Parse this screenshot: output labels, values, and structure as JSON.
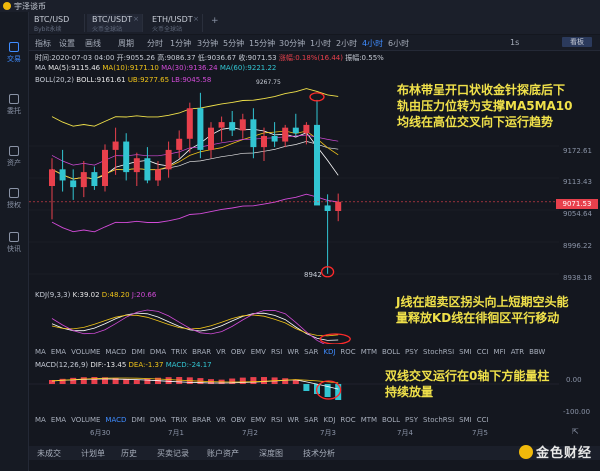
{
  "window": {
    "brand": "宇泽谈币"
  },
  "sidebar": {
    "items": [
      {
        "label": "交易",
        "icon": "candlestick-icon"
      },
      {
        "label": "委托",
        "icon": "order-icon"
      },
      {
        "label": "资产",
        "icon": "wallet-icon"
      },
      {
        "label": "授权",
        "icon": "key-icon"
      },
      {
        "label": "快讯",
        "icon": "news-icon"
      }
    ]
  },
  "symbols": [
    {
      "name": "BTC/USD",
      "sub": "Bybit永续"
    },
    {
      "name": "BTC/USDT",
      "sub": "火币全球站"
    },
    {
      "name": "ETH/USDT",
      "sub": "火币全球站"
    }
  ],
  "toolbar": {
    "items": [
      "指标",
      "设置",
      "画线",
      "周期",
      "分时",
      "1分钟",
      "3分钟",
      "5分钟",
      "15分钟",
      "30分钟",
      "1小时",
      "2小时",
      "4小时",
      "6小时"
    ],
    "active": "4小时",
    "extra": "1s",
    "big": "看板"
  },
  "info": {
    "time": "时间:2020-07-03 04:00",
    "open": "开:9055.26",
    "high": "高:9086.37",
    "low": "低:9036.67",
    "close": "收:9071.53",
    "change": "涨幅:0.18%(16.44)",
    "amp": "振幅:0.55%",
    "ma_label": "MA",
    "ma5": "MA(5):9115.46",
    "ma10": "MA(10):9171.10",
    "ma30": "MA(30):9136.24",
    "ma60": "MA(60):9221.22",
    "boll_label": "BOLL(20,2)",
    "boll": "BOLL:9161.61",
    "ub": "UB:9277.65",
    "lb": "LB:9045.58"
  },
  "price_axis": [
    "9172.61",
    "9113.43",
    "9054.64",
    "8996.22",
    "8938.18"
  ],
  "current_price": "9071.53",
  "low_marker": "8942",
  "high_marker": "9267.75",
  "annotations": {
    "boll": [
      "布林带呈开口状收金针探底后下",
      "轨由压力位转为支撑MA5MA10",
      "均线在高位交叉向下运行趋势"
    ],
    "kdj": [
      "J线在超卖区拐头向上短期空头能",
      "量释放KD线在徘徊区平行移动"
    ],
    "macd": [
      "双线交叉运行在0轴下方能量柱",
      "持续放量"
    ]
  },
  "kdj": {
    "label": "KDJ(9,3,3)",
    "k": "K:39.02",
    "d": "D:48.20",
    "j": "J:20.66"
  },
  "macd": {
    "label": "MACD(12,26,9)",
    "dif": "DIF:-13.45",
    "dea": "DEA:-1.37",
    "macd": "MACD:-24.17",
    "axis0": "0.00",
    "axis1": "-100.00"
  },
  "ind_tabs_1": [
    "MA",
    "EMA",
    "VOLUME",
    "MACD",
    "DMI",
    "DMA",
    "TRIX",
    "BRAR",
    "VR",
    "OBV",
    "EMV",
    "RSI",
    "WR",
    "SAR",
    "KDJ",
    "ROC",
    "MTM",
    "BOLL",
    "PSY",
    "StochRSI",
    "SMI",
    "CCI",
    "MFI",
    "ATR",
    "BBW"
  ],
  "ind_tabs_1_active": "KDJ",
  "ind_tabs_2": [
    "MA",
    "EMA",
    "VOLUME",
    "MACD",
    "DMI",
    "DMA",
    "TRIX",
    "BRAR",
    "VR",
    "OBV",
    "EMV",
    "RSI",
    "WR",
    "SAR",
    "KDJ",
    "ROC",
    "MTM",
    "BOLL",
    "PSY",
    "StochRSI",
    "SMI",
    "CCI"
  ],
  "ind_tabs_2_active": "MACD",
  "dates": [
    "6月30",
    "7月1",
    "7月2",
    "7月3",
    "7月4",
    "7月5"
  ],
  "bottom_tabs": [
    "未成交",
    "计划单",
    "历史",
    "买卖记录",
    "账户资产",
    "深度图",
    "技术分析"
  ],
  "watermark": "金色财经",
  "colors": {
    "up": "#e8404c",
    "down": "#32c5d2",
    "accent": "#3f8cff"
  },
  "chart_data": {
    "type": "candlestick",
    "interval": "4小时",
    "candles": [
      {
        "o": 9100,
        "h": 9150,
        "l": 9040,
        "c": 9130
      },
      {
        "o": 9130,
        "h": 9165,
        "l": 9090,
        "c": 9110
      },
      {
        "o": 9110,
        "h": 9130,
        "l": 9075,
        "c": 9098
      },
      {
        "o": 9098,
        "h": 9145,
        "l": 9080,
        "c": 9125
      },
      {
        "o": 9125,
        "h": 9135,
        "l": 9093,
        "c": 9100
      },
      {
        "o": 9100,
        "h": 9175,
        "l": 9090,
        "c": 9165
      },
      {
        "o": 9165,
        "h": 9205,
        "l": 9120,
        "c": 9180
      },
      {
        "o": 9180,
        "h": 9195,
        "l": 9110,
        "c": 9125
      },
      {
        "o": 9125,
        "h": 9160,
        "l": 9100,
        "c": 9150
      },
      {
        "o": 9150,
        "h": 9170,
        "l": 9105,
        "c": 9110
      },
      {
        "o": 9110,
        "h": 9145,
        "l": 9100,
        "c": 9130
      },
      {
        "o": 9130,
        "h": 9180,
        "l": 9115,
        "c": 9165
      },
      {
        "o": 9165,
        "h": 9200,
        "l": 9150,
        "c": 9185
      },
      {
        "o": 9185,
        "h": 9250,
        "l": 9160,
        "c": 9240
      },
      {
        "o": 9240,
        "h": 9267.75,
        "l": 9150,
        "c": 9165
      },
      {
        "o": 9165,
        "h": 9215,
        "l": 9150,
        "c": 9205
      },
      {
        "o": 9205,
        "h": 9225,
        "l": 9180,
        "c": 9215
      },
      {
        "o": 9215,
        "h": 9235,
        "l": 9190,
        "c": 9200
      },
      {
        "o": 9200,
        "h": 9230,
        "l": 9185,
        "c": 9220
      },
      {
        "o": 9220,
        "h": 9240,
        "l": 9150,
        "c": 9170
      },
      {
        "o": 9170,
        "h": 9205,
        "l": 9145,
        "c": 9190
      },
      {
        "o": 9190,
        "h": 9215,
        "l": 9170,
        "c": 9180
      },
      {
        "o": 9180,
        "h": 9210,
        "l": 9170,
        "c": 9205
      },
      {
        "o": 9205,
        "h": 9230,
        "l": 9190,
        "c": 9195
      },
      {
        "o": 9195,
        "h": 9215,
        "l": 9175,
        "c": 9210
      },
      {
        "o": 9210,
        "h": 9255,
        "l": 9140,
        "c": 9065
      },
      {
        "o": 9065,
        "h": 9085,
        "l": 8942,
        "c": 9055
      },
      {
        "o": 9055,
        "h": 9086.37,
        "l": 9036.67,
        "c": 9071.53
      }
    ],
    "ylim": [
      8920,
      9280
    ]
  }
}
